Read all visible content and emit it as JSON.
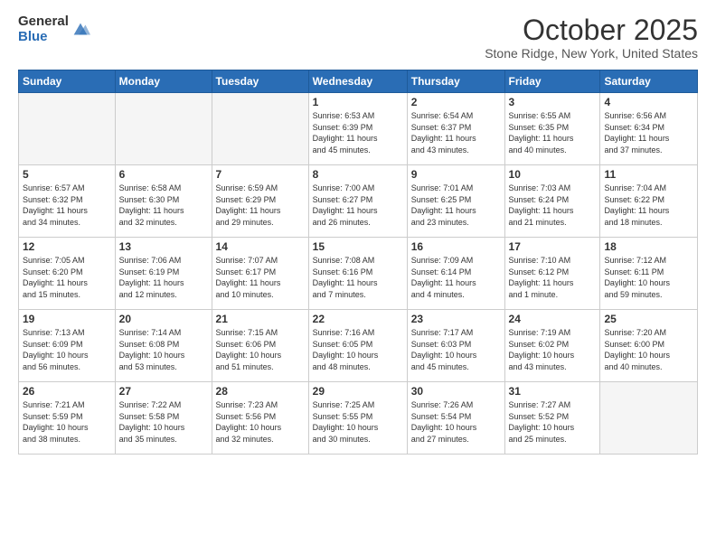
{
  "logo": {
    "general": "General",
    "blue": "Blue"
  },
  "header": {
    "month": "October 2025",
    "location": "Stone Ridge, New York, United States"
  },
  "weekdays": [
    "Sunday",
    "Monday",
    "Tuesday",
    "Wednesday",
    "Thursday",
    "Friday",
    "Saturday"
  ],
  "weeks": [
    [
      {
        "day": "",
        "info": ""
      },
      {
        "day": "",
        "info": ""
      },
      {
        "day": "",
        "info": ""
      },
      {
        "day": "1",
        "info": "Sunrise: 6:53 AM\nSunset: 6:39 PM\nDaylight: 11 hours\nand 45 minutes."
      },
      {
        "day": "2",
        "info": "Sunrise: 6:54 AM\nSunset: 6:37 PM\nDaylight: 11 hours\nand 43 minutes."
      },
      {
        "day": "3",
        "info": "Sunrise: 6:55 AM\nSunset: 6:35 PM\nDaylight: 11 hours\nand 40 minutes."
      },
      {
        "day": "4",
        "info": "Sunrise: 6:56 AM\nSunset: 6:34 PM\nDaylight: 11 hours\nand 37 minutes."
      }
    ],
    [
      {
        "day": "5",
        "info": "Sunrise: 6:57 AM\nSunset: 6:32 PM\nDaylight: 11 hours\nand 34 minutes."
      },
      {
        "day": "6",
        "info": "Sunrise: 6:58 AM\nSunset: 6:30 PM\nDaylight: 11 hours\nand 32 minutes."
      },
      {
        "day": "7",
        "info": "Sunrise: 6:59 AM\nSunset: 6:29 PM\nDaylight: 11 hours\nand 29 minutes."
      },
      {
        "day": "8",
        "info": "Sunrise: 7:00 AM\nSunset: 6:27 PM\nDaylight: 11 hours\nand 26 minutes."
      },
      {
        "day": "9",
        "info": "Sunrise: 7:01 AM\nSunset: 6:25 PM\nDaylight: 11 hours\nand 23 minutes."
      },
      {
        "day": "10",
        "info": "Sunrise: 7:03 AM\nSunset: 6:24 PM\nDaylight: 11 hours\nand 21 minutes."
      },
      {
        "day": "11",
        "info": "Sunrise: 7:04 AM\nSunset: 6:22 PM\nDaylight: 11 hours\nand 18 minutes."
      }
    ],
    [
      {
        "day": "12",
        "info": "Sunrise: 7:05 AM\nSunset: 6:20 PM\nDaylight: 11 hours\nand 15 minutes."
      },
      {
        "day": "13",
        "info": "Sunrise: 7:06 AM\nSunset: 6:19 PM\nDaylight: 11 hours\nand 12 minutes."
      },
      {
        "day": "14",
        "info": "Sunrise: 7:07 AM\nSunset: 6:17 PM\nDaylight: 11 hours\nand 10 minutes."
      },
      {
        "day": "15",
        "info": "Sunrise: 7:08 AM\nSunset: 6:16 PM\nDaylight: 11 hours\nand 7 minutes."
      },
      {
        "day": "16",
        "info": "Sunrise: 7:09 AM\nSunset: 6:14 PM\nDaylight: 11 hours\nand 4 minutes."
      },
      {
        "day": "17",
        "info": "Sunrise: 7:10 AM\nSunset: 6:12 PM\nDaylight: 11 hours\nand 1 minute."
      },
      {
        "day": "18",
        "info": "Sunrise: 7:12 AM\nSunset: 6:11 PM\nDaylight: 10 hours\nand 59 minutes."
      }
    ],
    [
      {
        "day": "19",
        "info": "Sunrise: 7:13 AM\nSunset: 6:09 PM\nDaylight: 10 hours\nand 56 minutes."
      },
      {
        "day": "20",
        "info": "Sunrise: 7:14 AM\nSunset: 6:08 PM\nDaylight: 10 hours\nand 53 minutes."
      },
      {
        "day": "21",
        "info": "Sunrise: 7:15 AM\nSunset: 6:06 PM\nDaylight: 10 hours\nand 51 minutes."
      },
      {
        "day": "22",
        "info": "Sunrise: 7:16 AM\nSunset: 6:05 PM\nDaylight: 10 hours\nand 48 minutes."
      },
      {
        "day": "23",
        "info": "Sunrise: 7:17 AM\nSunset: 6:03 PM\nDaylight: 10 hours\nand 45 minutes."
      },
      {
        "day": "24",
        "info": "Sunrise: 7:19 AM\nSunset: 6:02 PM\nDaylight: 10 hours\nand 43 minutes."
      },
      {
        "day": "25",
        "info": "Sunrise: 7:20 AM\nSunset: 6:00 PM\nDaylight: 10 hours\nand 40 minutes."
      }
    ],
    [
      {
        "day": "26",
        "info": "Sunrise: 7:21 AM\nSunset: 5:59 PM\nDaylight: 10 hours\nand 38 minutes."
      },
      {
        "day": "27",
        "info": "Sunrise: 7:22 AM\nSunset: 5:58 PM\nDaylight: 10 hours\nand 35 minutes."
      },
      {
        "day": "28",
        "info": "Sunrise: 7:23 AM\nSunset: 5:56 PM\nDaylight: 10 hours\nand 32 minutes."
      },
      {
        "day": "29",
        "info": "Sunrise: 7:25 AM\nSunset: 5:55 PM\nDaylight: 10 hours\nand 30 minutes."
      },
      {
        "day": "30",
        "info": "Sunrise: 7:26 AM\nSunset: 5:54 PM\nDaylight: 10 hours\nand 27 minutes."
      },
      {
        "day": "31",
        "info": "Sunrise: 7:27 AM\nSunset: 5:52 PM\nDaylight: 10 hours\nand 25 minutes."
      },
      {
        "day": "",
        "info": ""
      }
    ]
  ]
}
